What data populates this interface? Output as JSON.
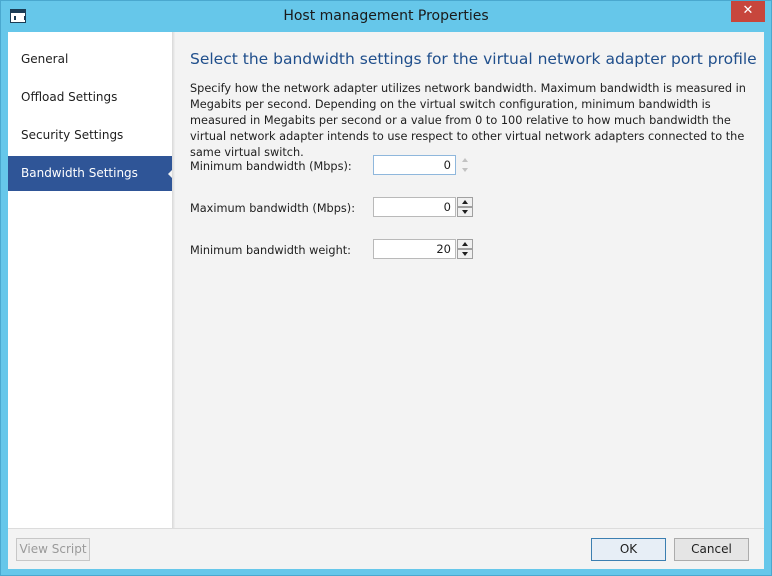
{
  "window": {
    "title": "Host management Properties",
    "close_glyph": "✕"
  },
  "sidebar": {
    "items": [
      {
        "label": "General",
        "selected": false
      },
      {
        "label": "Offload Settings",
        "selected": false
      },
      {
        "label": "Security Settings",
        "selected": false
      },
      {
        "label": "Bandwidth Settings",
        "selected": true
      }
    ]
  },
  "main": {
    "heading": "Select the bandwidth settings for the virtual network adapter port profile",
    "description": "Specify how the network adapter utilizes network bandwidth. Maximum bandwidth is measured in Megabits per second. Depending on the virtual switch configuration, minimum bandwidth is measured in Megabits per second or a value from 0 to 100 relative to how much bandwidth the virtual network adapter intends to use respect to other virtual network adapters connected to the same virtual switch.",
    "fields": [
      {
        "label": "Minimum bandwidth (Mbps):",
        "value": "0",
        "spinner_enabled": false
      },
      {
        "label": "Maximum bandwidth (Mbps):",
        "value": "0",
        "spinner_enabled": true
      },
      {
        "label": "Minimum bandwidth weight:",
        "value": "20",
        "spinner_enabled": true
      }
    ]
  },
  "footer": {
    "view_script_label": "View Script",
    "ok_label": "OK",
    "cancel_label": "Cancel"
  },
  "colors": {
    "titlebar": "#66c7ea",
    "selected_nav": "#2f5597",
    "heading": "#204f8c",
    "close_button": "#c7463c"
  },
  "icons": {
    "app": "window-icon",
    "close": "close-icon",
    "spin_up": "chevron-up-icon",
    "spin_down": "chevron-down-icon"
  }
}
